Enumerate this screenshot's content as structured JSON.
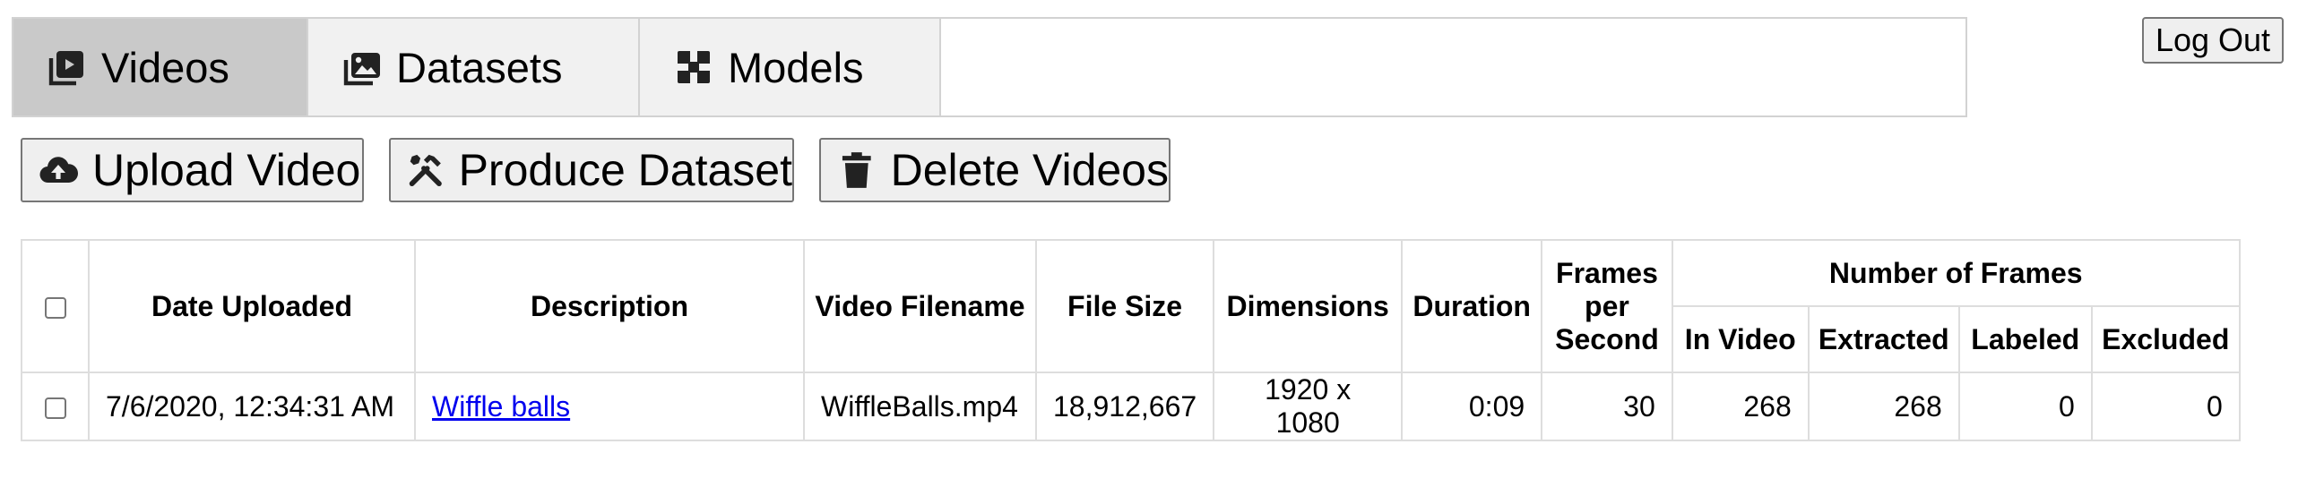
{
  "tabs": [
    {
      "label": "Videos",
      "icon": "video-icon",
      "active": true
    },
    {
      "label": "Datasets",
      "icon": "images-icon",
      "active": false
    },
    {
      "label": "Models",
      "icon": "model-icon",
      "active": false
    }
  ],
  "header": {
    "logout_label": "Log Out"
  },
  "toolbar": {
    "upload_label": "Upload Video",
    "produce_label": "Produce Dataset",
    "delete_label": "Delete Videos"
  },
  "table": {
    "headers": {
      "date_uploaded": "Date Uploaded",
      "description": "Description",
      "video_filename": "Video Filename",
      "file_size": "File Size",
      "dimensions": "Dimensions",
      "duration": "Duration",
      "fps": "Frames per Second",
      "number_of_frames": "Number of Frames",
      "in_video": "In Video",
      "extracted": "Extracted",
      "labeled": "Labeled",
      "excluded": "Excluded"
    },
    "rows": [
      {
        "date_uploaded": "7/6/2020, 12:34:31 AM",
        "description": "Wiffle balls",
        "video_filename": "WiffleBalls.mp4",
        "file_size": "18,912,667",
        "dimensions": "1920 x 1080",
        "duration": "0:09",
        "fps": "30",
        "in_video": "268",
        "extracted": "268",
        "labeled": "0",
        "excluded": "0"
      }
    ]
  }
}
